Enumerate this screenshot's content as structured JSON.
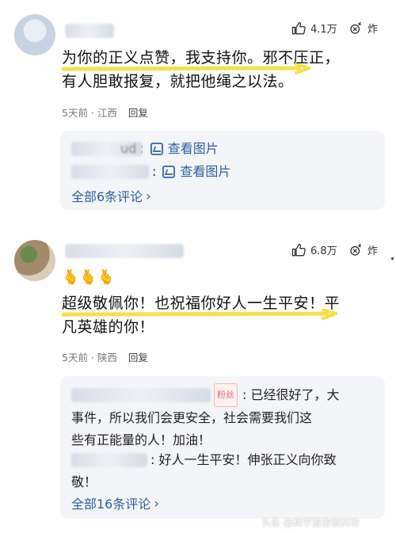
{
  "comments": [
    {
      "likes": "4.1万",
      "burst_label": "炸",
      "text_lines": [
        "为你的正义点赞，我支持你。邪不压正，",
        "有人胆敢报复，就把他绳之以法。"
      ],
      "time": "5天前",
      "location": "江西",
      "reply_label": "回复",
      "replies": [
        {
          "name_suffix": "ud",
          "link": "查看图片"
        },
        {
          "name_suffix": "",
          "link": "查看图片"
        }
      ],
      "more": "全部6条评论"
    },
    {
      "likes": "6.8万",
      "burst_label": "炸",
      "emojis": "🫰🫰🫰",
      "text_lines": [
        "超级敬佩你！也祝福你好人一生平安！平",
        "凡英雄的你！"
      ],
      "time": "5天前",
      "location": "陕西",
      "reply_label": "回复",
      "replies": [
        {
          "badge": "粉丝",
          "lines": [
            ": 已经很好了，大",
            "事件，所以我们会更安全，社会需要我们这",
            "些有正能量的人！加油！"
          ]
        },
        {
          "lines": [
            ": 好人一生平安！伸张正义向你致",
            "敬！"
          ]
        }
      ],
      "more": "全部16条评论"
    }
  ],
  "separator_dot": "·",
  "chevron": "›",
  "watermark": "头条 @辉宇游游侃科坊"
}
